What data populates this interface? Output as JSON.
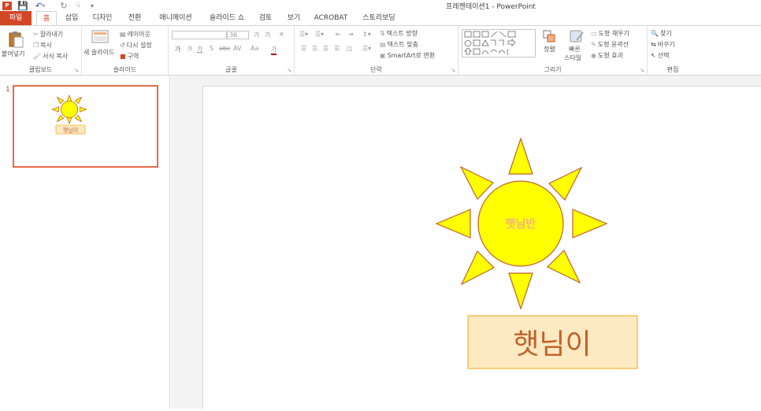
{
  "app": {
    "title": "프레젠테이션1 - PowerPoint",
    "icon_text": "P"
  },
  "quick_access": [
    "save-icon",
    "undo-icon",
    "redo-icon",
    "touch-mode-icon",
    "customize-icon"
  ],
  "tabs": [
    "파일",
    "홈",
    "삽입",
    "디자인",
    "전환",
    "애니메이션",
    "슬라이드 쇼",
    "검토",
    "보기",
    "ACROBAT",
    "스토리보딩"
  ],
  "active_tab": "홈",
  "ribbon": {
    "clipboard": {
      "paste": "붙여넣기",
      "cut": "잘라내기",
      "copy": "복사",
      "format_painter": "서식 복사",
      "label": "클립보드"
    },
    "slides": {
      "new_slide": "새 슬라이드",
      "layout": "레이아웃",
      "reset": "다시 설정",
      "section": "구역",
      "label": "슬라이드"
    },
    "font": {
      "font_name": "",
      "font_size": "36",
      "grow": "가",
      "shrink": "가",
      "bold": "가",
      "italic": "가",
      "underline": "가",
      "shadow": "S",
      "strike": "abc",
      "spacing": "AV",
      "case": "Aa",
      "color": "가",
      "label": "글꼴"
    },
    "paragraph": {
      "text_direction": "텍스트 방향",
      "align_text": "텍스트 맞춤",
      "smartart": "SmartArt로 변환",
      "label": "단락"
    },
    "drawing": {
      "arrange": "정렬",
      "quick_styles_line1": "빠른",
      "quick_styles_line2": "스타일",
      "shape_fill": "도형 채우기",
      "shape_outline": "도형 윤곽선",
      "shape_effects": "도형 효과",
      "label": "그리기"
    },
    "editing": {
      "find": "찾기",
      "replace": "바꾸기",
      "select": "선택",
      "label": "편집"
    }
  },
  "slides_pane": {
    "slide_number": "1",
    "thumb_sun_text": "",
    "thumb_box_text": "햇님이"
  },
  "slide": {
    "sun_text": "햇님반",
    "box_text": "햇님이"
  },
  "colors": {
    "accent": "#d24726",
    "sun_fill": "#ffff00",
    "sun_outline": "#c0612b",
    "sun_text": "#f4b183",
    "box_fill": "#fde9c2",
    "box_outline": "#f2b533",
    "box_text": "#c0612b",
    "thumb_border": "#e46c4a"
  }
}
